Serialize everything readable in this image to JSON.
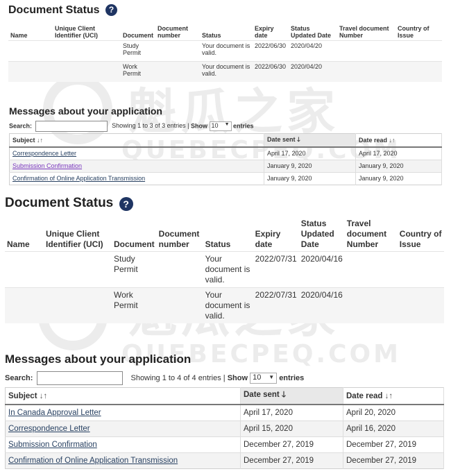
{
  "watermark": {
    "cn": "魁瓜之家",
    "en": "QUEBECPEQ.COM"
  },
  "panel1": {
    "doc_title": "Document Status",
    "help_icon": "?",
    "columns": [
      "Name",
      "Unique Client Identifier (UCI)",
      "Document",
      "Document number",
      "Status",
      "Expiry date",
      "Status Updated Date",
      "Travel document Number",
      "Country of Issue"
    ],
    "rows": [
      {
        "name": "",
        "uci": "",
        "document": "Study Permit",
        "number": "",
        "status": "Your document is valid.",
        "expiry": "2022/06/30",
        "updated": "2020/04/20",
        "travel": "",
        "country": ""
      },
      {
        "name": "",
        "uci": "",
        "document": "Work Permit",
        "number": "",
        "status": "Your document is valid.",
        "expiry": "2022/06/30",
        "updated": "2020/04/20",
        "travel": "",
        "country": ""
      }
    ],
    "messages_title": "Messages about your application",
    "search_label": "Search:",
    "search_value": "",
    "showing": "Showing 1 to 3 of 3 entries |",
    "show_label": "Show",
    "show_value": "10",
    "entries_label": "entries",
    "msg_headers": {
      "subject": "Subject",
      "date_sent": "Date sent",
      "date_read": "Date read"
    },
    "messages": [
      {
        "subject": "Correspondence Letter",
        "sent": "April 17, 2020",
        "read": "April 17, 2020"
      },
      {
        "subject": "Submission Confirmation",
        "sent": "January 9, 2020",
        "read": "January 9, 2020"
      },
      {
        "subject": "Confirmation of Online Application Transmission",
        "sent": "January 9, 2020",
        "read": "January 9, 2020"
      }
    ]
  },
  "panel2": {
    "doc_title": "Document Status",
    "help_icon": "?",
    "columns": [
      "Name",
      "Unique Client Identifier (UCI)",
      "Document",
      "Document number",
      "Status",
      "Expiry date",
      "Status Updated Date",
      "Travel document Number",
      "Country of Issue"
    ],
    "rows": [
      {
        "name": "",
        "uci": "",
        "document": "Study Permit",
        "number": "",
        "status": "Your document is valid.",
        "expiry": "2022/07/31",
        "updated": "2020/04/16",
        "travel": "",
        "country": ""
      },
      {
        "name": "",
        "uci": "",
        "document": "Work Permit",
        "number": "",
        "status": "Your document is valid.",
        "expiry": "2022/07/31",
        "updated": "2020/04/16",
        "travel": "",
        "country": ""
      }
    ],
    "messages_title": "Messages about your application",
    "search_label": "Search:",
    "search_value": "",
    "showing": "Showing 1 to 4 of 4 entries |",
    "show_label": "Show",
    "show_value": "10",
    "entries_label": "entries",
    "msg_headers": {
      "subject": "Subject",
      "date_sent": "Date sent",
      "date_read": "Date read"
    },
    "messages": [
      {
        "subject": "In Canada Approval Letter",
        "sent": "April 17, 2020",
        "read": "April 20, 2020"
      },
      {
        "subject": "Correspondence Letter",
        "sent": "April 15, 2020",
        "read": "April 16, 2020"
      },
      {
        "subject": "Submission Confirmation",
        "sent": "December 27, 2019",
        "read": "December 27, 2019"
      },
      {
        "subject": "Confirmation of Online Application Transmission",
        "sent": "December 27, 2019",
        "read": "December 27, 2019"
      }
    ]
  },
  "colors": {
    "link": "#284162",
    "visited_link": "#7834bc",
    "help_icon_bg": "#1f3563",
    "row_alt": "#f5f5f5"
  }
}
